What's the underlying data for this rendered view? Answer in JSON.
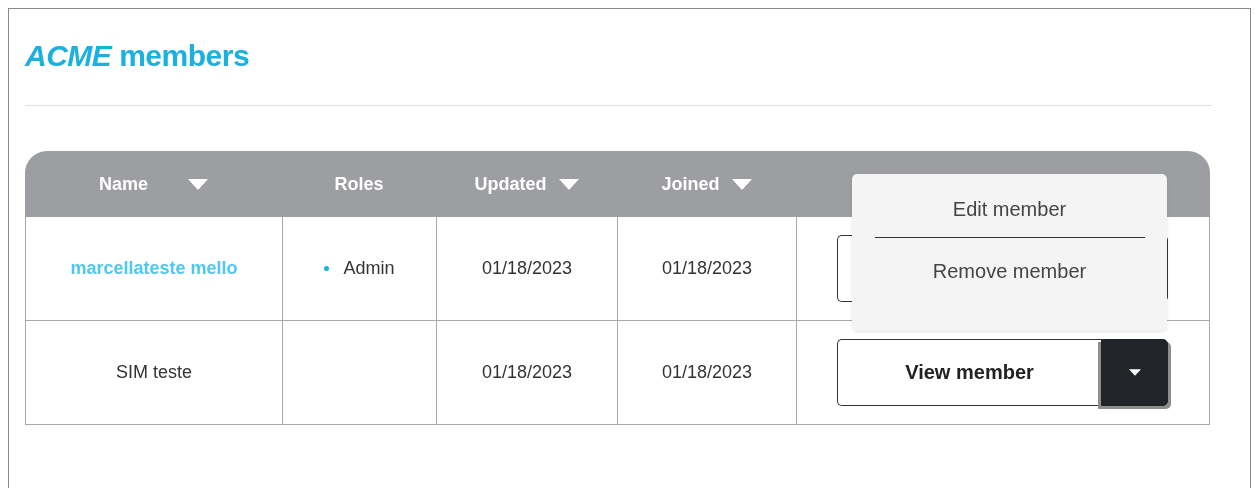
{
  "title": "*ACME* members",
  "table": {
    "columns": [
      {
        "label": "Name",
        "sortable": true
      },
      {
        "label": "Roles",
        "sortable": false
      },
      {
        "label": "Updated",
        "sortable": true
      },
      {
        "label": "Joined",
        "sortable": true
      }
    ],
    "rows": [
      {
        "name": "marcellateste mello",
        "is_link": true,
        "roles": [
          "Admin"
        ],
        "updated": "01/18/2023",
        "joined": "01/18/2023",
        "action": {}
      },
      {
        "name": "SIM teste",
        "is_link": false,
        "roles": [],
        "updated": "01/18/2023",
        "joined": "01/18/2023",
        "action": {
          "label": "View member",
          "menu_open": true
        }
      }
    ]
  },
  "menu": {
    "items": [
      "Edit member",
      "Remove member"
    ]
  }
}
